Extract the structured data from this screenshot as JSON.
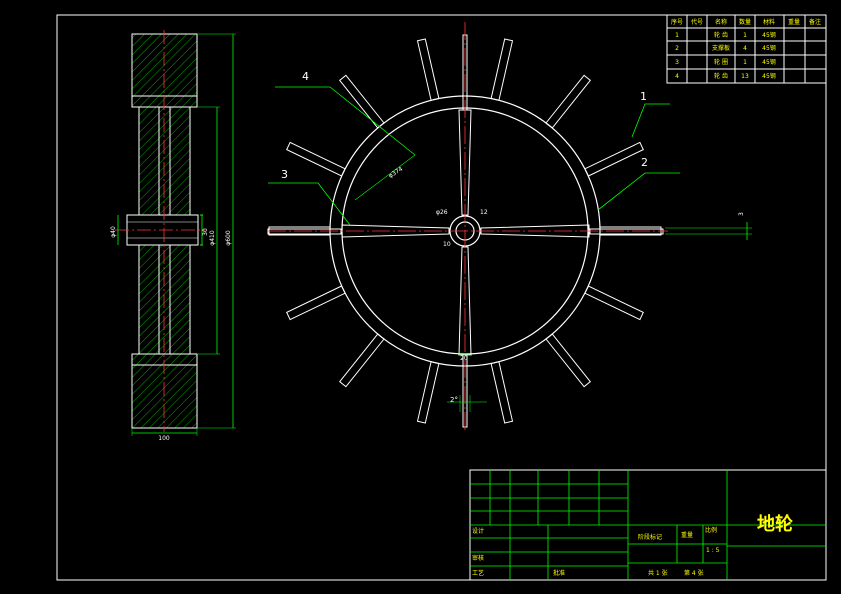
{
  "title_block": {
    "part_name": "地轮",
    "designer_label": "设计",
    "reviewer_label": "审核",
    "process_label": "工艺",
    "approve_label": "批准",
    "stage_label": "阶段标记",
    "weight_label": "重量",
    "scale_label": "比例",
    "scale_value": "1 : 5",
    "sheets_total": "共 1 张",
    "sheet_no": "第 4 张"
  },
  "bom": {
    "headers": [
      "序号",
      "代号",
      "名称",
      "数量",
      "材料",
      "重量",
      "备注"
    ],
    "rows": [
      [
        "1",
        "",
        "轮 齿",
        "1",
        "45钢",
        "",
        ""
      ],
      [
        "2",
        "",
        "支撑板",
        "4",
        "45钢",
        "",
        ""
      ],
      [
        "3",
        "",
        "轮 圈",
        "1",
        "45钢",
        "",
        ""
      ],
      [
        "4",
        "",
        "轮 齿",
        "13",
        "45钢",
        "",
        ""
      ]
    ]
  },
  "balloons": [
    "1",
    "2",
    "3",
    "4"
  ],
  "dimensions": {
    "side_width": "100",
    "dia_410": "φ410",
    "dia_600": "φ600",
    "dia_40": "φ40",
    "hub_len": "30",
    "rim_dia": "φ374",
    "hub_dia": "φ26",
    "hub_inner": "10",
    "hub_outer": "12",
    "tooth_thk": "3",
    "spoke_w": "20",
    "angle": "2°"
  }
}
